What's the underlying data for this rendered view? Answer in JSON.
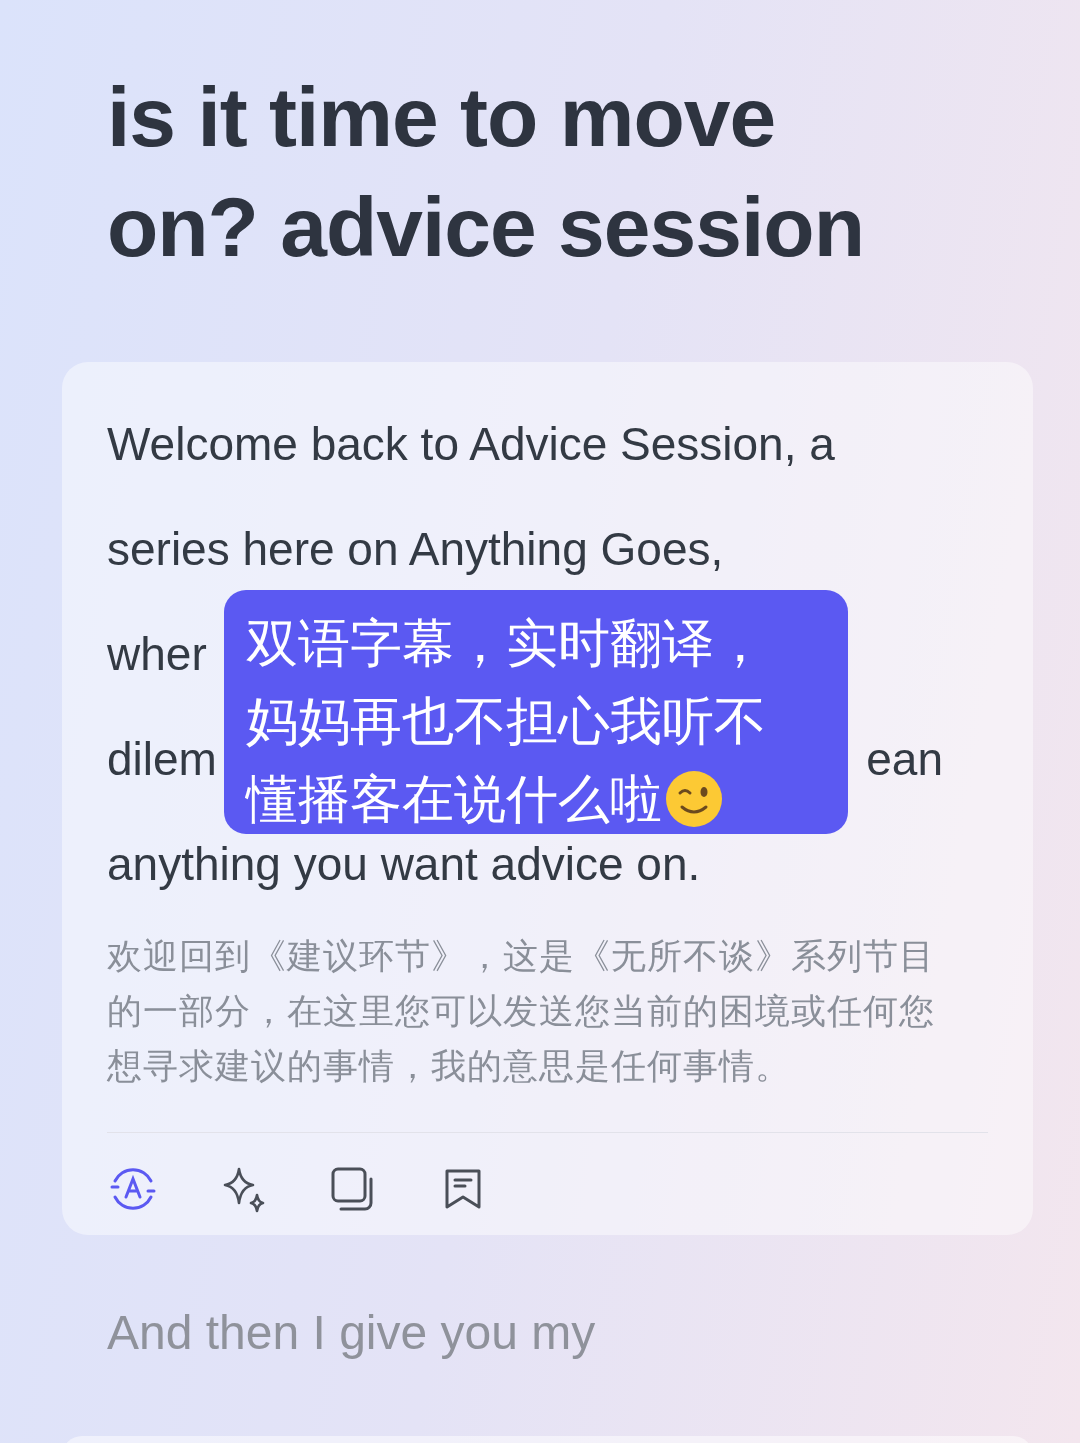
{
  "title": "is it time to move on? advice session",
  "transcript": {
    "lines": [
      {
        "segments": [
          "Welcome back to Advice Session, a"
        ]
      },
      {
        "segments": [
          "series here on Anything Goes,"
        ]
      },
      {
        "segments": [
          "wher"
        ]
      },
      {
        "segments": [
          "dilem",
          "ean"
        ]
      },
      {
        "segments": [
          "anything you want advice on."
        ]
      }
    ],
    "translation": "欢迎回到《建议环节》，这是《无所不谈》系列节目的一部分，在这里您可以发送您当前的困境或任何您想寻求建议的事情，我的意思是任何事情。",
    "actions": [
      {
        "kind": "translate",
        "selected": true
      },
      {
        "kind": "sparkle",
        "selected": false
      },
      {
        "kind": "copy",
        "selected": false
      },
      {
        "kind": "note",
        "selected": false
      }
    ]
  },
  "next_line": "And then I give you my",
  "overlay": {
    "lines": [
      "双语字幕，实时翻译，",
      "妈妈再也不担心我听不",
      "懂播客在说什么啦"
    ]
  }
}
